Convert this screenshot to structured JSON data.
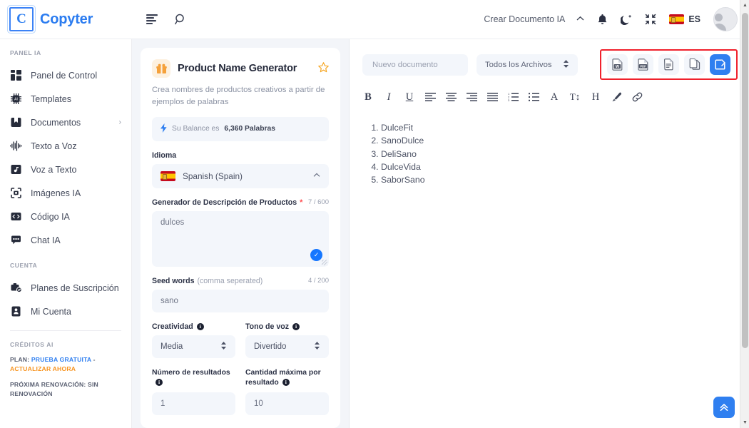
{
  "brand": {
    "logo_letter": "C",
    "name": "Copyter"
  },
  "topbar": {
    "menu_icon": "menu-icon",
    "search_icon": "search-icon",
    "create_document_label": "Crear Documento IA",
    "chevron": "⌃",
    "bell_icon": "bell-icon",
    "dark_mode_icon": "moon-icon",
    "fullscreen_icon": "compress-icon",
    "language_code": "ES",
    "avatar": "user-avatar"
  },
  "sidebar": {
    "section_panel": "PANEL IA",
    "items": [
      {
        "label": "Panel de Control",
        "icon": "dashboard-icon"
      },
      {
        "label": "Templates",
        "icon": "chip-ai-icon"
      },
      {
        "label": "Documentos",
        "icon": "documents-icon",
        "caret": "›"
      },
      {
        "label": "Texto a Voz",
        "icon": "waveform-icon"
      },
      {
        "label": "Voz a Texto",
        "icon": "audio-file-icon"
      },
      {
        "label": "Imágenes IA",
        "icon": "image-scan-icon"
      },
      {
        "label": "Código IA",
        "icon": "code-icon"
      },
      {
        "label": "Chat IA",
        "icon": "chat-icon"
      }
    ],
    "section_account": "CUENTA",
    "account_items": [
      {
        "label": "Planes de Suscripción",
        "icon": "subscription-icon"
      },
      {
        "label": "Mi Cuenta",
        "icon": "account-card-icon"
      }
    ],
    "section_credits": "CRÉDITOS AI",
    "plan_prefix": "PLAN:",
    "plan_value": "PRUEBA GRATUITA",
    "plan_sep": "-",
    "plan_action": "ACTUALIZAR AHORA",
    "renewal": "PRÓXIMA RENOVACIÓN: SIN RENOVACIÓN"
  },
  "tool": {
    "icon": "gift-box-icon",
    "title": "Product Name Generator",
    "star_icon": "star-icon",
    "description": "Crea nombres de productos creativos a partir de ejemplos de palabras",
    "balance_text_pre": "Su Balance es",
    "balance_value": "6,360 Palabras",
    "language_label": "Idioma",
    "language_value": "Spanish (Spain)",
    "prompt_label": "Generador de Descripción de Productos",
    "prompt_required": "*",
    "prompt_counter": "7 / 600",
    "prompt_value": "dulces",
    "seed_label": "Seed words",
    "seed_label_soft": "(comma seperated)",
    "seed_counter": "4 / 200",
    "seed_value": "sano",
    "creativity_label": "Creatividad",
    "creativity_value": "Media",
    "tone_label": "Tono de voz",
    "tone_value": "Divertido",
    "results_label": "Número de resultados",
    "results_value": "1",
    "max_label": "Cantidad máxima por resultado",
    "max_value": "10"
  },
  "editor": {
    "doc_name_placeholder": "Nuevo documento",
    "file_filter_value": "Todos los Archivos",
    "format_buttons": [
      {
        "name": "bold-icon",
        "glyph": "B"
      },
      {
        "name": "italic-icon",
        "glyph": "I"
      },
      {
        "name": "underline-icon",
        "glyph": "U"
      },
      {
        "name": "align-left-icon",
        "glyph": "≡"
      },
      {
        "name": "align-center-icon",
        "glyph": "≡"
      },
      {
        "name": "align-right-icon",
        "glyph": "≡"
      },
      {
        "name": "align-justify-icon",
        "glyph": "≡"
      },
      {
        "name": "ordered-list-icon",
        "glyph": "≔"
      },
      {
        "name": "unordered-list-icon",
        "glyph": "≔"
      },
      {
        "name": "font-family-icon",
        "glyph": "A"
      },
      {
        "name": "font-size-icon",
        "glyph": "T↕"
      },
      {
        "name": "heading-icon",
        "glyph": "H"
      },
      {
        "name": "highlight-icon",
        "glyph": "✎"
      }
    ],
    "export_buttons": [
      {
        "name": "export-word-button",
        "label": "W"
      },
      {
        "name": "export-pdf-button",
        "label": "PDF"
      },
      {
        "name": "export-txt-button",
        "label": "TXT"
      },
      {
        "name": "copy-document-button",
        "label": "COPY"
      },
      {
        "name": "save-document-button",
        "label": "SAVE"
      }
    ],
    "results": [
      "DulceFit",
      "SanoDulce",
      "DeliSano",
      "DulceVida",
      "SaborSano"
    ],
    "scroll_top_icon": "double-chevron-up-icon"
  },
  "colors": {
    "accent": "#2f7ff0",
    "highlight_box": "#f0212c",
    "orange": "#f7931e",
    "panel_bg": "#f3f5f9",
    "field_bg": "#f3f6fb"
  }
}
